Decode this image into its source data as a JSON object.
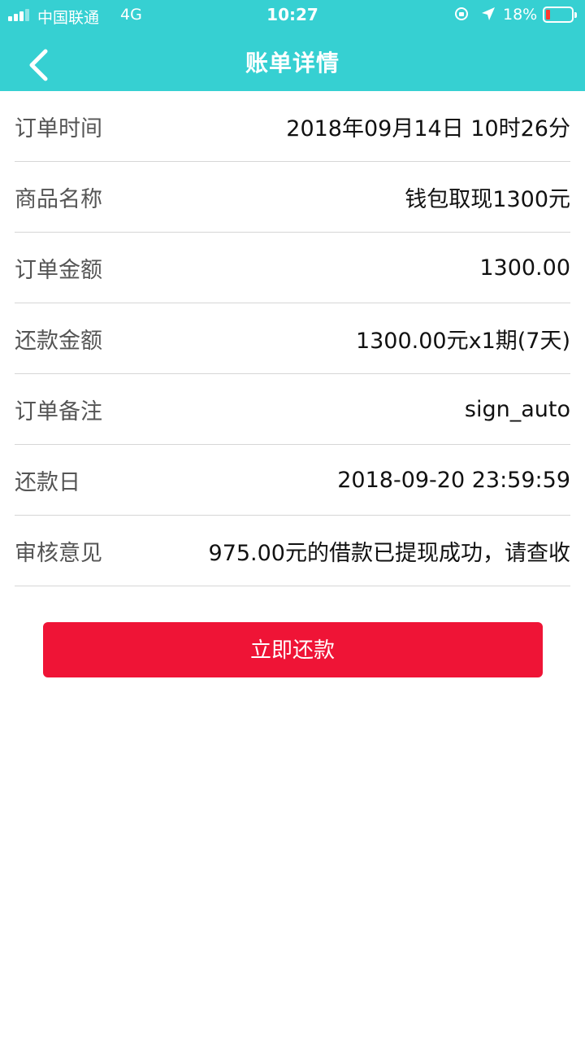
{
  "status_bar": {
    "carrier": "中国联通",
    "network": "4G",
    "time": "10:27",
    "battery_percent": "18%"
  },
  "nav": {
    "title": "账单详情",
    "back_icon": "chevron-left-icon"
  },
  "rows": [
    {
      "label": "订单时间",
      "value": "2018年09月14日 10时26分"
    },
    {
      "label": "商品名称",
      "value": "钱包取现1300元"
    },
    {
      "label": "订单金额",
      "value": "1300.00"
    },
    {
      "label": "还款金额",
      "value": "1300.00元x1期(7天)"
    },
    {
      "label": "订单备注",
      "value": "sign_auto"
    },
    {
      "label": "还款日",
      "value": "2018-09-20 23:59:59"
    },
    {
      "label": "审核意见",
      "value": "975.00元的借款已提现成功，请查收"
    }
  ],
  "actions": {
    "repay_label": "立即还款"
  },
  "colors": {
    "header_bg": "#36d0d2",
    "button_bg": "#ef1436",
    "battery_low": "#ff3b30"
  }
}
